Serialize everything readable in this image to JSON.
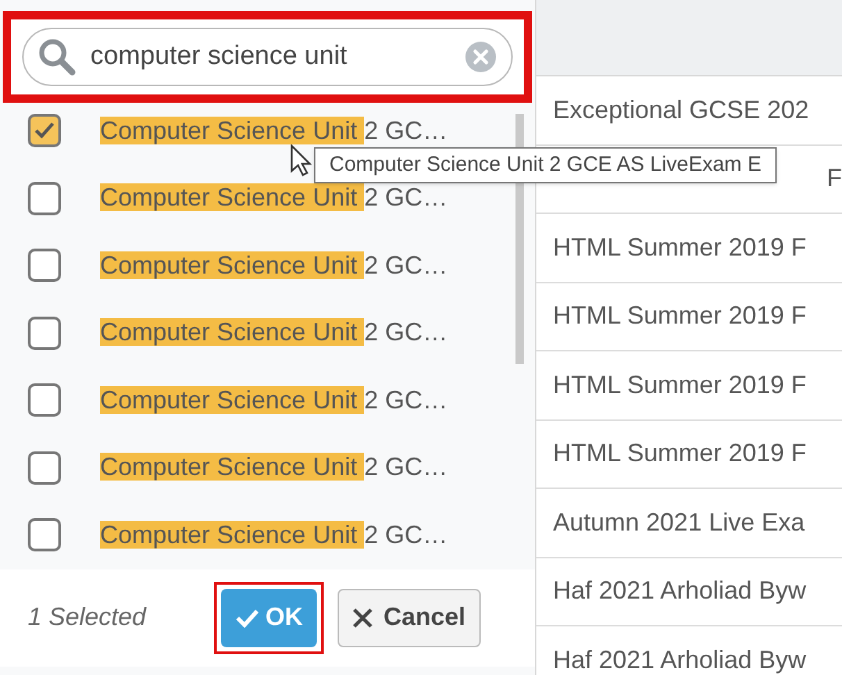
{
  "search": {
    "value": "computer science unit"
  },
  "items": [
    {
      "match": "Computer Science Unit",
      "rest": "2 GC…",
      "checked": true
    },
    {
      "match": "Computer Science Unit",
      "rest": "2 GC…",
      "checked": false
    },
    {
      "match": "Computer Science Unit",
      "rest": "2 GC…",
      "checked": false
    },
    {
      "match": "Computer Science Unit",
      "rest": "2 GC…",
      "checked": false
    },
    {
      "match": "Computer Science Unit",
      "rest": "2 GC…",
      "checked": false
    },
    {
      "match": "Computer Science Unit",
      "rest": "2 GC…",
      "checked": false
    },
    {
      "match": "Computer Science Unit",
      "rest": "2 GC…",
      "checked": false
    }
  ],
  "tooltip": "Computer Science Unit 2 GCE AS LiveExam E",
  "footer": {
    "count": "1 Selected",
    "ok": "OK",
    "cancel": "Cancel"
  },
  "table_rows": [
    {
      "kind": "text",
      "text": "Exceptional GCSE 202"
    },
    {
      "kind": "covered",
      "text": "F"
    },
    {
      "kind": "text",
      "text": "HTML Summer 2019 F"
    },
    {
      "kind": "text",
      "text": "HTML Summer 2019 F"
    },
    {
      "kind": "text",
      "text": "HTML Summer 2019 F"
    },
    {
      "kind": "text",
      "text": "HTML Summer 2019 F"
    },
    {
      "kind": "text",
      "text": "Autumn 2021 Live Exa"
    },
    {
      "kind": "text",
      "text": "Haf 2021 Arholiad Byw"
    },
    {
      "kind": "text",
      "text": "Haf 2021 Arholiad Byw"
    }
  ]
}
